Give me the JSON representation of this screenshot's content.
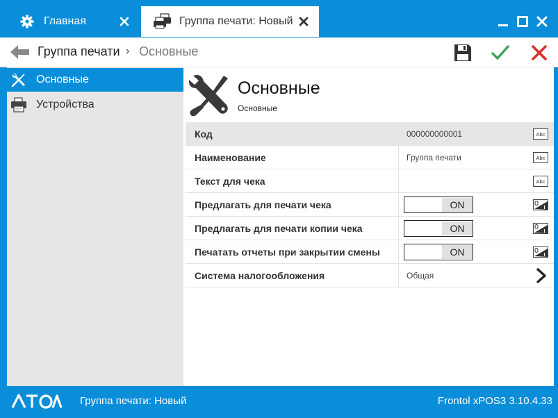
{
  "tabs": [
    {
      "label": "Главная",
      "icon": "gear-icon"
    },
    {
      "label": "Группа печати: Новый",
      "icon": "printer-group-icon"
    }
  ],
  "breadcrumb": {
    "parent": "Группа печати",
    "separator": "›",
    "current": "Основные"
  },
  "toolbar": {
    "save": "save-icon",
    "ok": "checkmark-icon",
    "cancel": "close-icon"
  },
  "sidebar": {
    "items": [
      {
        "label": "Основные",
        "icon": "tools-icon",
        "active": true
      },
      {
        "label": "Устройства",
        "icon": "printer-icon",
        "active": false
      }
    ]
  },
  "page": {
    "title": "Основные",
    "subtitle": "Основные"
  },
  "fields": [
    {
      "label": "Код",
      "value": "000000000001",
      "type": "text"
    },
    {
      "label": "Наименование",
      "value": "Группа печати",
      "type": "text"
    },
    {
      "label": "Текст для чека",
      "value": "",
      "type": "text"
    },
    {
      "label": "Предлагать для печати чека",
      "toggle": "ON",
      "type": "bool"
    },
    {
      "label": "Предлагать для печати копии чека",
      "toggle": "ON",
      "type": "bool"
    },
    {
      "label": "Печатать отчеты при закрытии смены",
      "toggle": "ON",
      "type": "bool"
    },
    {
      "label": "Система налогообложения",
      "value": "Общая",
      "type": "select"
    }
  ],
  "field_type_label": "Abc",
  "status": {
    "logo": "АТОЛ",
    "document": "Группа печати: Новый",
    "version": "Frontol xPOS3 3.10.4.33"
  },
  "colors": {
    "accent": "#0a8ed9",
    "sidebar": "#e6e6e6",
    "ok": "#3aa55a",
    "cancel": "#d9302a"
  }
}
